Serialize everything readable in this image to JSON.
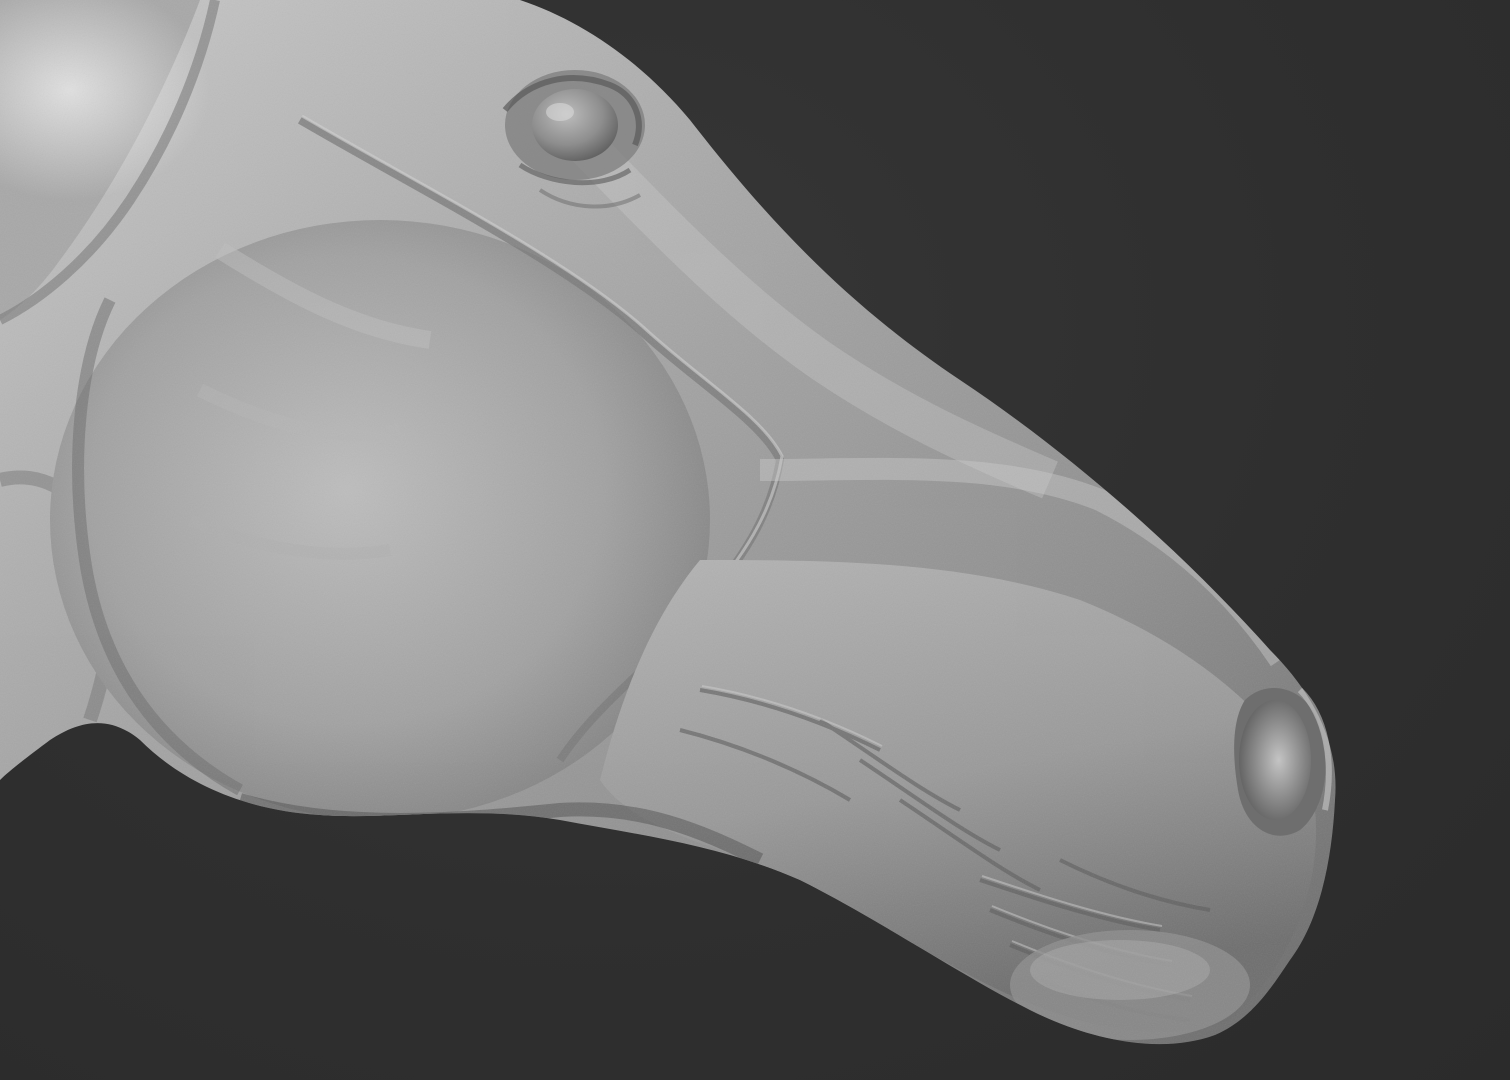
{
  "viewport": {
    "background_color": "#2f2f2f",
    "subject": "horse-head-sculpt",
    "material_color": "#9c9c9c",
    "highlight_color": "#d2d2d2",
    "shadow_color": "#5a5a5a"
  }
}
